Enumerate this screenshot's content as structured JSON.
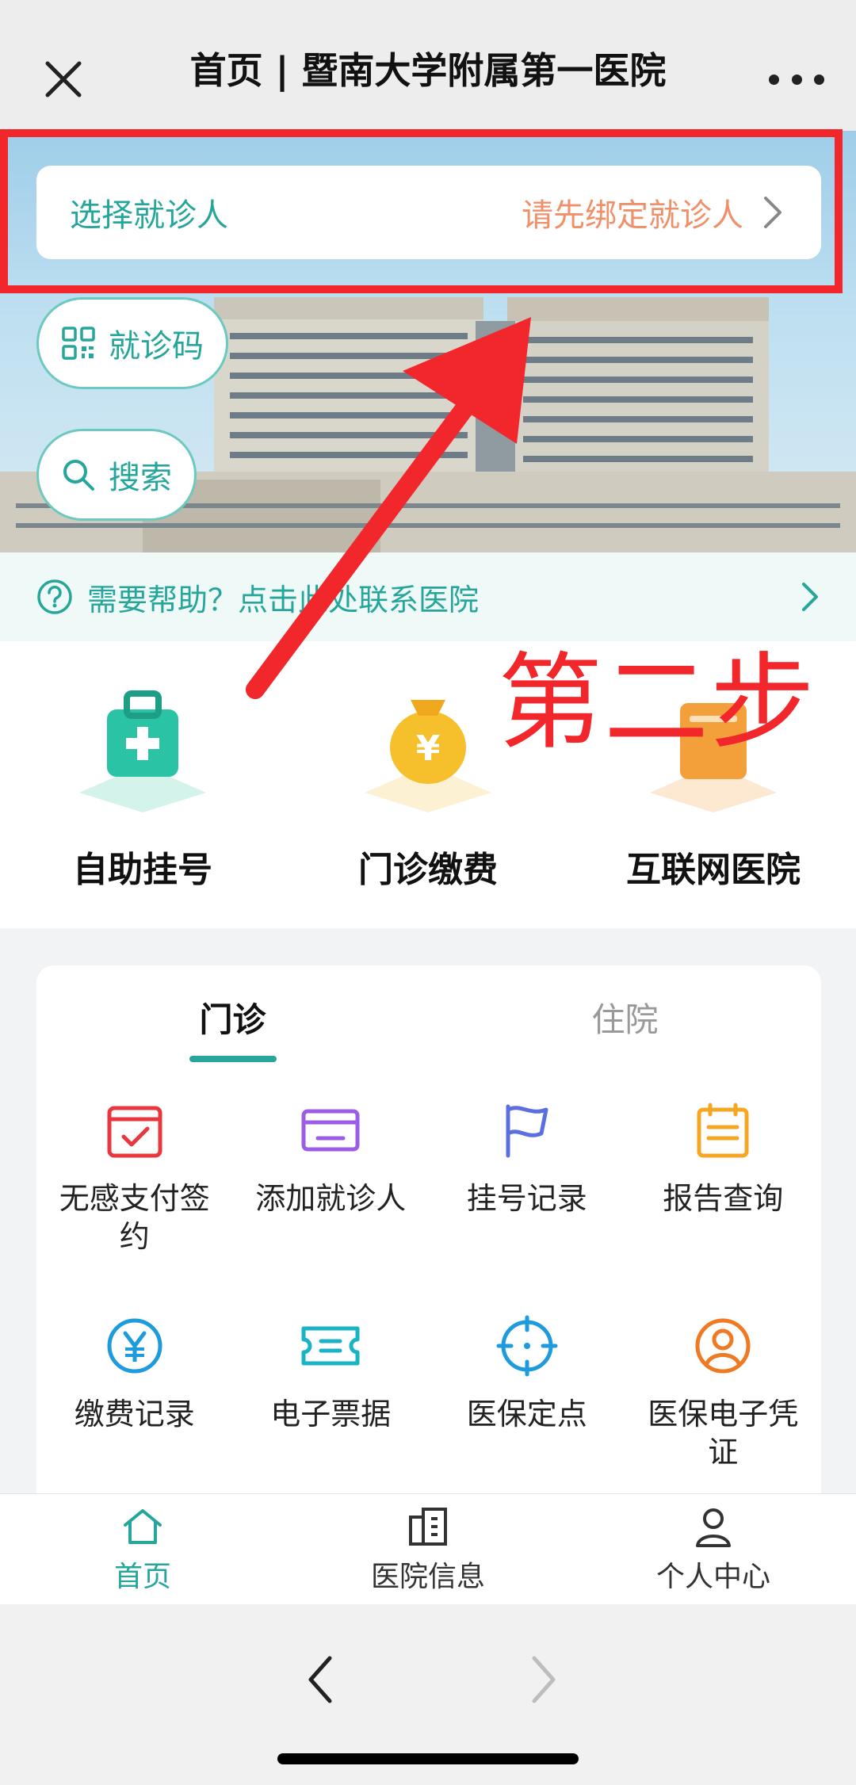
{
  "header": {
    "title": "首页 | 暨南大学附属第一医院"
  },
  "hero": {
    "patient_label": "选择就诊人",
    "patient_hint": "请先绑定就诊人",
    "code_button": "就诊码",
    "search_button": "搜索"
  },
  "help": {
    "text": "需要帮助？点击此处联系医院"
  },
  "quick_actions": [
    {
      "label": "自助挂号",
      "icon": "medical-kit-icon",
      "color": "#2bc3a5"
    },
    {
      "label": "门诊缴费",
      "icon": "money-bag-icon",
      "color": "#f6c02c"
    },
    {
      "label": "互联网医院",
      "icon": "folder-icon",
      "color": "#f4a03a"
    }
  ],
  "annotation": {
    "text": "第二步"
  },
  "services": {
    "tabs": [
      {
        "label": "门诊",
        "active": true
      },
      {
        "label": "住院",
        "active": false
      }
    ],
    "items": [
      {
        "label": "无感支付签约",
        "icon": "calendar-check-icon",
        "color": "#e8373f"
      },
      {
        "label": "添加就诊人",
        "icon": "card-icon",
        "color": "#9b5de5"
      },
      {
        "label": "挂号记录",
        "icon": "flag-icon",
        "color": "#5b6fe0"
      },
      {
        "label": "报告查询",
        "icon": "calendar-report-icon",
        "color": "#f5a623"
      },
      {
        "label": "缴费记录",
        "icon": "yen-circle-icon",
        "color": "#1e9bdc"
      },
      {
        "label": "电子票据",
        "icon": "ticket-icon",
        "color": "#1ab3c6"
      },
      {
        "label": "医保定点",
        "icon": "crosshair-icon",
        "color": "#1e9bdc"
      },
      {
        "label": "医保电子凭证",
        "icon": "user-circle-icon",
        "color": "#f07a24"
      }
    ]
  },
  "bottom_nav": [
    {
      "label": "首页",
      "icon": "home-icon",
      "active": true
    },
    {
      "label": "医院信息",
      "icon": "building-icon",
      "active": false
    },
    {
      "label": "个人中心",
      "icon": "person-icon",
      "active": false
    }
  ],
  "accent_color": "#26a69a"
}
